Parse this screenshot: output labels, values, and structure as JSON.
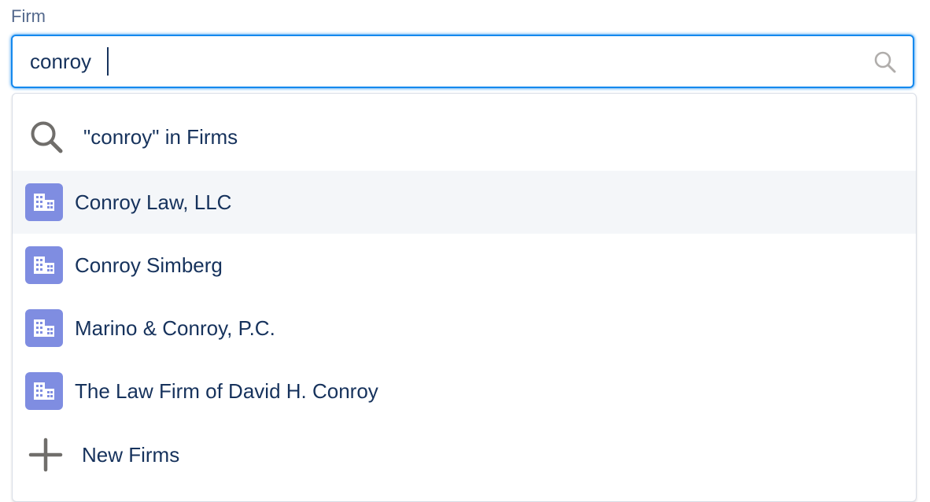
{
  "field": {
    "label": "Firm",
    "value": "conroy"
  },
  "dropdown": {
    "search_option": "\"conroy\" in Firms",
    "results": [
      {
        "label": "Conroy Law, LLC",
        "icon": "building-icon"
      },
      {
        "label": "Conroy Simberg",
        "icon": "building-icon"
      },
      {
        "label": "Marino & Conroy, P.C.",
        "icon": "building-icon"
      },
      {
        "label": "The Law Firm of David H. Conroy",
        "icon": "building-icon"
      }
    ],
    "new_option": "New Firms"
  },
  "colors": {
    "focus_border": "#1589ee",
    "record_icon_bg": "#7f8de1",
    "text": "#16325c",
    "label": "#54698d",
    "hover_bg": "#f4f6f9"
  }
}
